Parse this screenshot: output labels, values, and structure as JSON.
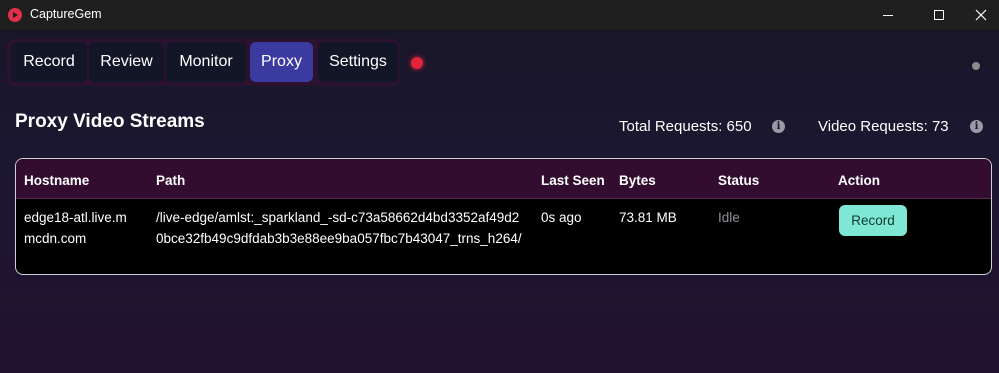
{
  "window": {
    "title": "CaptureGem",
    "app_icon": "capturegem-logo-icon"
  },
  "nav": {
    "tabs": [
      {
        "label": "Record",
        "active": false
      },
      {
        "label": "Review",
        "active": false
      },
      {
        "label": "Monitor",
        "active": false
      },
      {
        "label": "Proxy",
        "active": true
      },
      {
        "label": "Settings",
        "active": false
      }
    ],
    "recording_indicator_color": "#e0243a",
    "connection_status_color": "#8a8a8a"
  },
  "page": {
    "title": "Proxy Video Streams",
    "total_requests": "Total Requests: 650",
    "video_requests": "Video Requests: 73"
  },
  "table": {
    "columns": [
      "Hostname",
      "Path",
      "Last Seen",
      "Bytes",
      "Status",
      "Action"
    ],
    "rows": [
      {
        "hostname": "edge18-atl.live.mmcdn.com",
        "path": "/live-edge/amlst:_sparkland_-sd-c73a58662d4bd3352af49d20bce32fb49c9dfdab3b3e88ee9ba057fbc7b43047_trns_h264/",
        "last_seen": "0s ago",
        "bytes": "73.81 MB",
        "status": "Idle",
        "action": "Record"
      }
    ]
  },
  "colors": {
    "active_tab": "#3a3aa0",
    "record_button": "#7fe8d4",
    "table_header": "#330d30"
  }
}
